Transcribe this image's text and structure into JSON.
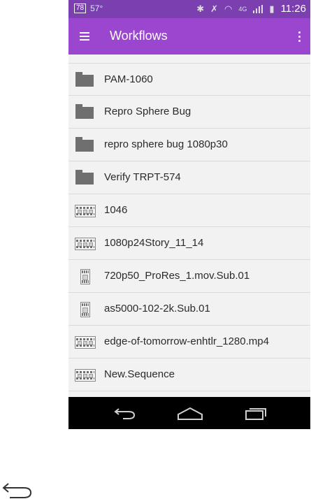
{
  "status_bar": {
    "badge": "78",
    "temperature": "57°",
    "network": "4G",
    "time": "11:26"
  },
  "app_bar": {
    "title": "Workflows"
  },
  "items": [
    {
      "type": "folder",
      "label": "PAM-1060"
    },
    {
      "type": "folder",
      "label": "Repro Sphere Bug"
    },
    {
      "type": "folder",
      "label": "repro sphere bug 1080p30"
    },
    {
      "type": "folder",
      "label": "Verify TRPT-574"
    },
    {
      "type": "sequence",
      "label": "1046"
    },
    {
      "type": "sequence",
      "label": "1080p24Story_11_14"
    },
    {
      "type": "clip",
      "label": "720p50_ProRes_1.mov.Sub.01"
    },
    {
      "type": "clip",
      "label": "as5000-102-2k.Sub.01"
    },
    {
      "type": "sequence",
      "label": "edge-of-tomorrow-enhtlr_1280.mp4"
    },
    {
      "type": "sequence",
      "label": "New.Sequence"
    }
  ],
  "colors": {
    "app_bar": "#9a46cf",
    "status_bar": "#7b3fb0",
    "nav_bar": "#000000"
  },
  "icons": {
    "folder": "folder-icon",
    "sequence": "filmstrip-icon",
    "clip": "clip-icon"
  }
}
